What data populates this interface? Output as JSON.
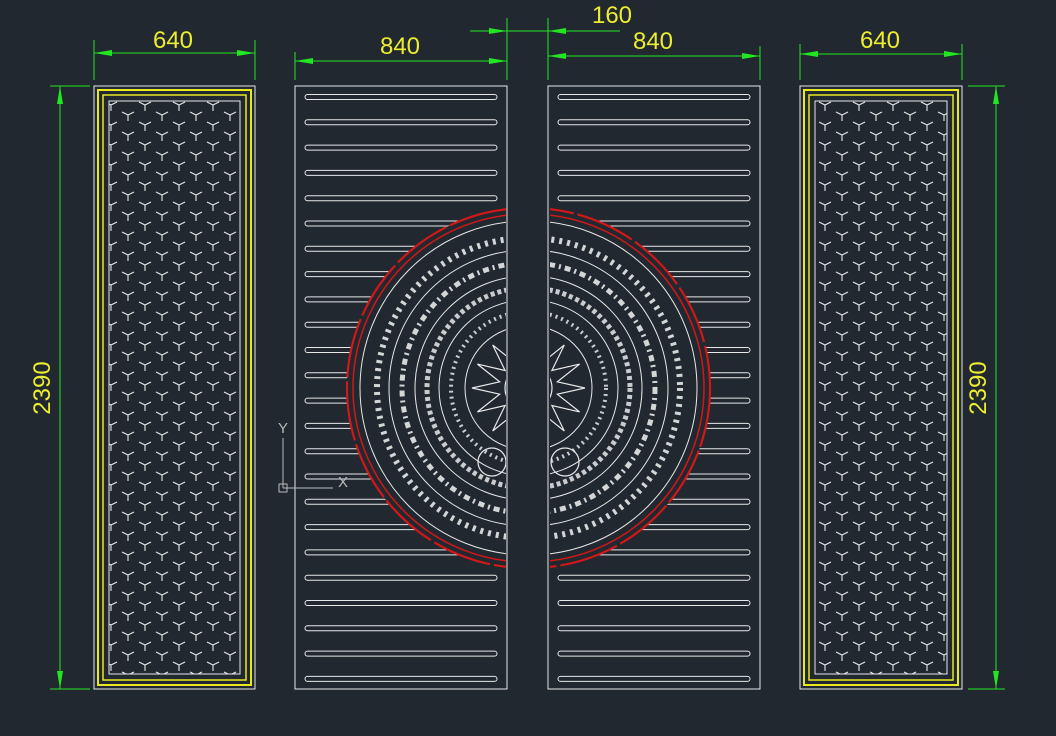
{
  "drawing": {
    "dimensions": {
      "left_panel_width": "640",
      "left_door_width": "840",
      "gap_width": "160",
      "right_door_width": "840",
      "right_panel_width": "640",
      "left_height": "2390",
      "right_height": "2390"
    },
    "ucs": {
      "x_label": "X",
      "y_label": "Y"
    },
    "colors": {
      "background": "#212830",
      "panel_outline": "#e8e8e8",
      "frame_yellow": "#e8e820",
      "dimension_green": "#22e622",
      "dimension_text": "#ecec30",
      "ring_red": "#d01818",
      "ucs_gray": "#bbbbbb"
    }
  }
}
